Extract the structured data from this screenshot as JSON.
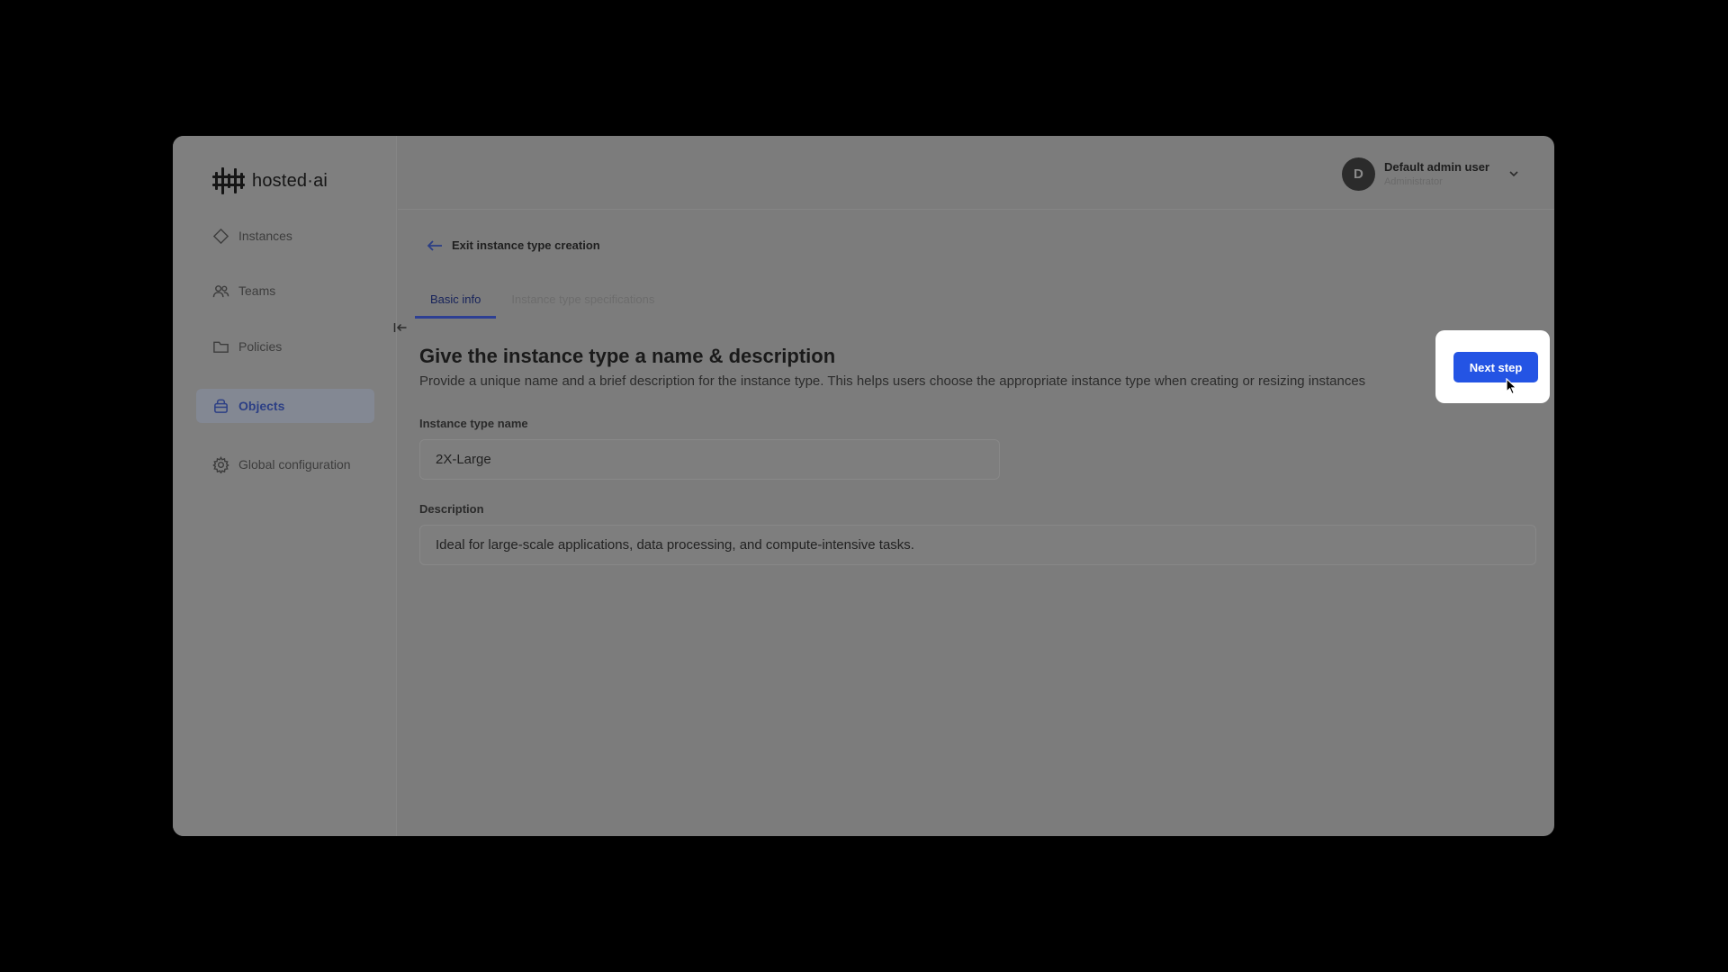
{
  "brand": {
    "name": "hosted·ai"
  },
  "sidebar": {
    "items": [
      {
        "label": "Instances",
        "icon": "diamond-icon",
        "active": false
      },
      {
        "label": "Teams",
        "icon": "users-icon",
        "active": false
      },
      {
        "label": "Policies",
        "icon": "folder-icon",
        "active": false
      },
      {
        "label": "Objects",
        "icon": "box-icon",
        "active": true
      },
      {
        "label": "Global configuration",
        "icon": "gear-icon",
        "active": false
      }
    ]
  },
  "user": {
    "initial": "D",
    "name": "Default admin user",
    "role": "Administrator"
  },
  "main": {
    "back_label": "Exit instance type creation",
    "tabs": [
      {
        "label": "Basic info",
        "active": true
      },
      {
        "label": "Instance type specifications",
        "active": false
      }
    ],
    "section_title": "Give the instance type a name & description",
    "section_description": "Provide a unique name and a brief description for the instance type. This helps users choose the appropriate instance type when creating or resizing instances",
    "fields": {
      "name": {
        "label": "Instance type name",
        "value": "2X-Large"
      },
      "description": {
        "label": "Description",
        "value": "Ideal for large-scale applications, data processing, and compute-intensive tasks."
      }
    }
  },
  "callout": {
    "next_step_label": "Next step"
  },
  "colors": {
    "background": "#000000",
    "dimmed_window": "#7c7c7c",
    "accent": "#2454e4",
    "active_nav_text": "#2c3f85",
    "callout_background": "#ffffff"
  }
}
